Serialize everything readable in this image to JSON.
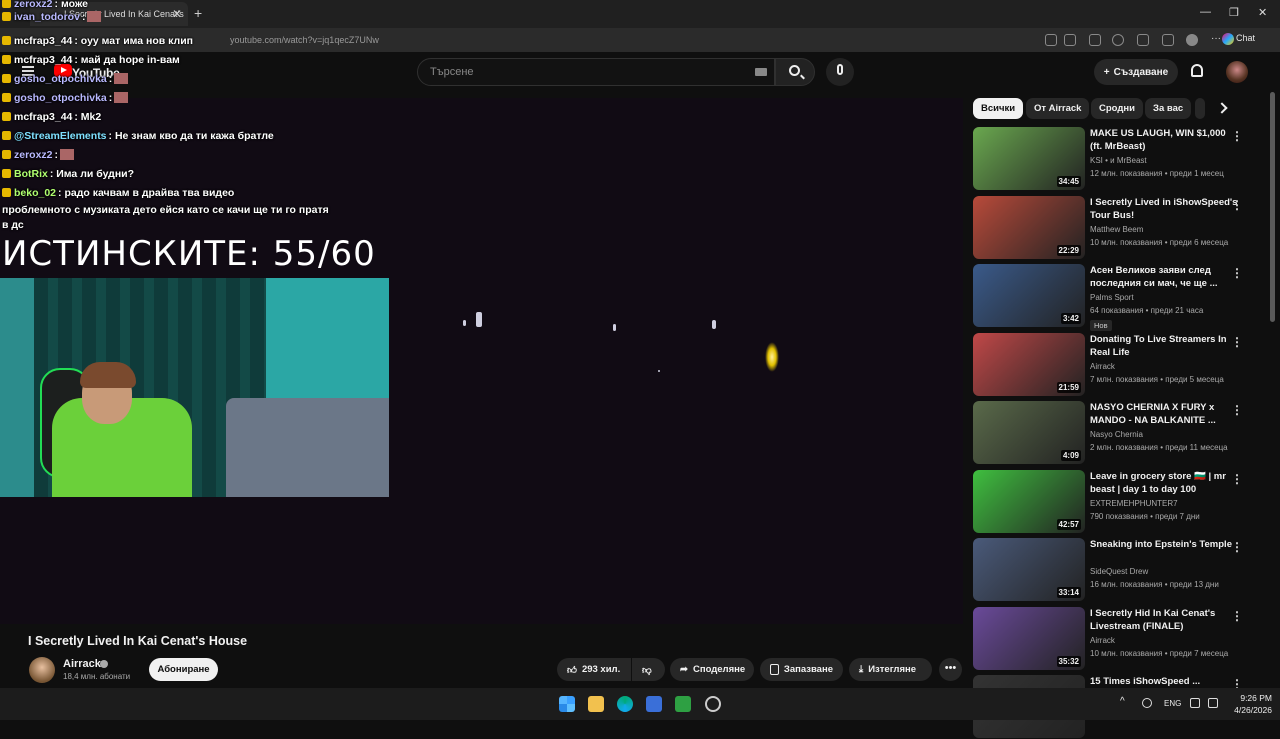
{
  "browser": {
    "tab_title": "I Secretly Lived In Kai Cenat's",
    "url": "youtube.com/watch?v=jq1qecZ7UNw",
    "chat_button": "Chat"
  },
  "youtube": {
    "logo": "YouTube",
    "search_placeholder": "Търсене",
    "create_label": "Създаване"
  },
  "stream": {
    "counter": "ИСТИНСКИТЕ: 55/60",
    "chat": [
      {
        "user": "zeroxz2",
        "color": "#b9b9ff",
        "text": ": може",
        "emote": false
      },
      {
        "user": "ivan_todorov",
        "color": "#b9b9ff",
        "text": ":",
        "emote": true
      },
      {
        "user": "mcfrap3_44",
        "color": "#ffffff",
        "text": ": оуу мат има нов клип",
        "emote": false
      },
      {
        "user": "mcfrap3_44",
        "color": "#ffffff",
        "text": ": май да hope in-вам",
        "emote": false
      },
      {
        "user": "gosho_otpochivka",
        "color": "#b9b9ff",
        "text": ":",
        "emote": true
      },
      {
        "user": "gosho_otpochivka",
        "color": "#b9b9ff",
        "text": ":",
        "emote": true
      },
      {
        "user": "mcfrap3_44",
        "color": "#ffffff",
        "text": ": Mk2",
        "emote": false
      },
      {
        "user": "@StreamElements",
        "color": "#7fe0ff",
        "text": ": Не знам кво да ти кажа братле",
        "emote": false
      },
      {
        "user": "zeroxz2",
        "color": "#b9b9ff",
        "text": ":",
        "emote": true
      },
      {
        "user": "BotRix",
        "color": "#b0ff70",
        "text": ": Има ли будни?",
        "emote": false
      },
      {
        "user": "beko_02",
        "color": "#b0ff70",
        "text": ": радо качвам в драйва тва видео",
        "emote": false
      },
      {
        "user": "",
        "color": "#ffffff",
        "text": "проблемното с музиката дето ейся като се качи ще ти го пратя",
        "emote": false
      },
      {
        "user": "",
        "color": "#ffffff",
        "text": "в дс",
        "emote": false
      }
    ]
  },
  "video": {
    "title": "I Secretly Lived In Kai Cenat's House",
    "channel": "Airrack",
    "subscribers": "18,4 млн. абонати",
    "subscribe_label": "Абониране",
    "likes": "293 хил.",
    "share_label": "Споделяне",
    "save_label": "Запазване",
    "download_label": "Изтегляне"
  },
  "chips": [
    "Всички",
    "От Airrack",
    "Сродни",
    "За вас"
  ],
  "recommendations": [
    {
      "title": "MAKE US LAUGH, WIN $1,000 (ft. MrBeast)",
      "channel": "KSI • и MrBeast",
      "meta": "12 млн. показвания • преди 1 месец",
      "duration": "34:45",
      "color": "#6aa84f",
      "badge": ""
    },
    {
      "title": "I Secretly Lived in iShowSpeed's Tour Bus!",
      "channel": "Matthew Beem",
      "meta": "10 млн. показвания • преди 6 месеца",
      "duration": "22:29",
      "color": "#b84a3a",
      "badge": ""
    },
    {
      "title": "Асен Великов заяви след последния си мач, че ще ...",
      "channel": "Palms Sport",
      "meta": "64 показвания • преди 21 часа",
      "duration": "3:42",
      "color": "#3a5a8a",
      "badge": "Нов"
    },
    {
      "title": "Donating To Live Streamers In Real Life",
      "channel": "Airrack",
      "meta": "7 млн. показвания • преди 5 месеца",
      "duration": "21:59",
      "color": "#c04848",
      "badge": ""
    },
    {
      "title": "NASYO CHERNIA X FURY x MANDO - NA BALKANITE ...",
      "channel": "Nasyo Chernia",
      "meta": "2 млн. показвания • преди 11 месеца",
      "duration": "4:09",
      "color": "#5a6a4a",
      "badge": ""
    },
    {
      "title": "Leave in grocery store 🇧🇬 | mr beast | day 1 to day 100",
      "channel": "EXTREMEHPHUNTER7",
      "meta": "790 показвания • преди 7 дни",
      "duration": "42:57",
      "color": "#3fbf3f",
      "badge": ""
    },
    {
      "title": "Sneaking into Epstein's Temple",
      "channel": "SideQuest Drew",
      "meta": "16 млн. показвания • преди 13 дни",
      "duration": "33:14",
      "color": "#4a5a7a",
      "badge": ""
    },
    {
      "title": "I Secretly Hid In Kai Cenat's Livestream (FINALE)",
      "channel": "Airrack",
      "meta": "10 млн. показвания • преди 7 месеца",
      "duration": "35:32",
      "color": "#6a4a9a",
      "badge": ""
    },
    {
      "title": "15 Times iShowSpeed ...",
      "channel": "",
      "meta": "",
      "duration": "",
      "color": "#333333",
      "badge": ""
    }
  ],
  "taskbar": {
    "lang": "ENG",
    "time": "9:26 PM",
    "date": "4/26/2026"
  },
  "icons": [
    "hamburger-icon",
    "search-icon",
    "mic-icon",
    "bell-icon",
    "like-icon",
    "dislike-icon",
    "share-icon",
    "save-icon",
    "download-icon",
    "more-icon",
    "chevron-right-icon",
    "windows-start-icon"
  ]
}
